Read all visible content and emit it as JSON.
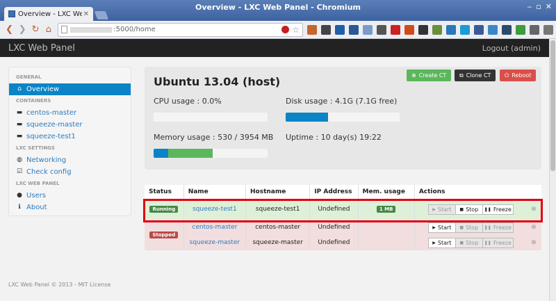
{
  "browser": {
    "window_title": "Overview - LXC Web Panel - Chromium",
    "tab_title": "Overview - LXC Web P",
    "url": ":5000/home"
  },
  "navbar": {
    "brand": "LXC Web Panel",
    "logout": "Logout (admin)"
  },
  "sidebar": {
    "general_header": "GENERAL",
    "overview": "Overview",
    "containers_header": "CONTAINERS",
    "containers": [
      "centos-master",
      "squeeze-master",
      "squeeze-test1"
    ],
    "lxc_settings_header": "LXC SETTINGS",
    "networking": "Networking",
    "check_config": "Check config",
    "lxc_web_panel_header": "LXC WEB PANEL",
    "users": "Users",
    "about": "About"
  },
  "host": {
    "title": "Ubuntu 13.04 (host)",
    "create_btn": "Create CT",
    "clone_btn": "Clone CT",
    "reboot_btn": "Reboot",
    "cpu_label": "CPU usage : 0.0%",
    "cpu_fraction": 0.0,
    "disk_label": "Disk usage : 4.1G (7.1G free)",
    "disk_fraction": 0.37,
    "memory_label": "Memory usage : 530 / 3954 MB",
    "memory_used_fraction": 0.13,
    "memory_cached_fraction": 0.39,
    "uptime_label": "Uptime : 10 day(s) 19:22",
    "colors": {
      "primary": "#0a84c7",
      "success": "#5bb75b",
      "danger": "#da4f49"
    }
  },
  "table": {
    "headers": [
      "Status",
      "Name",
      "Hostname",
      "IP Address",
      "Mem. usage",
      "Actions"
    ],
    "rows": [
      {
        "status": "Running",
        "name": "squeeze-test1",
        "hostname": "squeeze-test1",
        "ip": "Undefined",
        "mem": "1 MB"
      },
      {
        "status": "",
        "name": "centos-master",
        "hostname": "centos-master",
        "ip": "Undefined",
        "mem": ""
      },
      {
        "status": "Stopped",
        "name": "squeeze-master",
        "hostname": "squeeze-master",
        "ip": "Undefined",
        "mem": ""
      }
    ],
    "actions": {
      "start": "Start",
      "stop": "Stop",
      "freeze": "Freeze"
    }
  },
  "footer": "LXC Web Panel © 2013 - MIT License"
}
